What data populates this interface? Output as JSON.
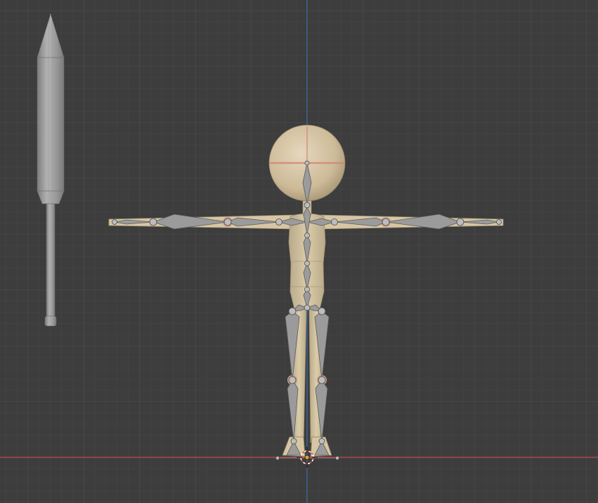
{
  "viewport": {
    "view": "front-orthographic",
    "background_color": "#3d3d3d",
    "grid_minor_color": "#474747",
    "grid_major_color": "#505050",
    "x_axis_color": "#c44a4f",
    "z_axis_color": "#3e6ea6"
  },
  "scene": {
    "objects": [
      {
        "name": "sword",
        "kind": "mesh",
        "color": "#9a9a9a"
      },
      {
        "name": "character-body",
        "kind": "mesh",
        "color": "#d9c9a6"
      },
      {
        "name": "armature",
        "kind": "armature",
        "color": "#9b9b9b"
      },
      {
        "name": "3d-cursor",
        "kind": "cursor",
        "color": "#e04646"
      }
    ]
  }
}
